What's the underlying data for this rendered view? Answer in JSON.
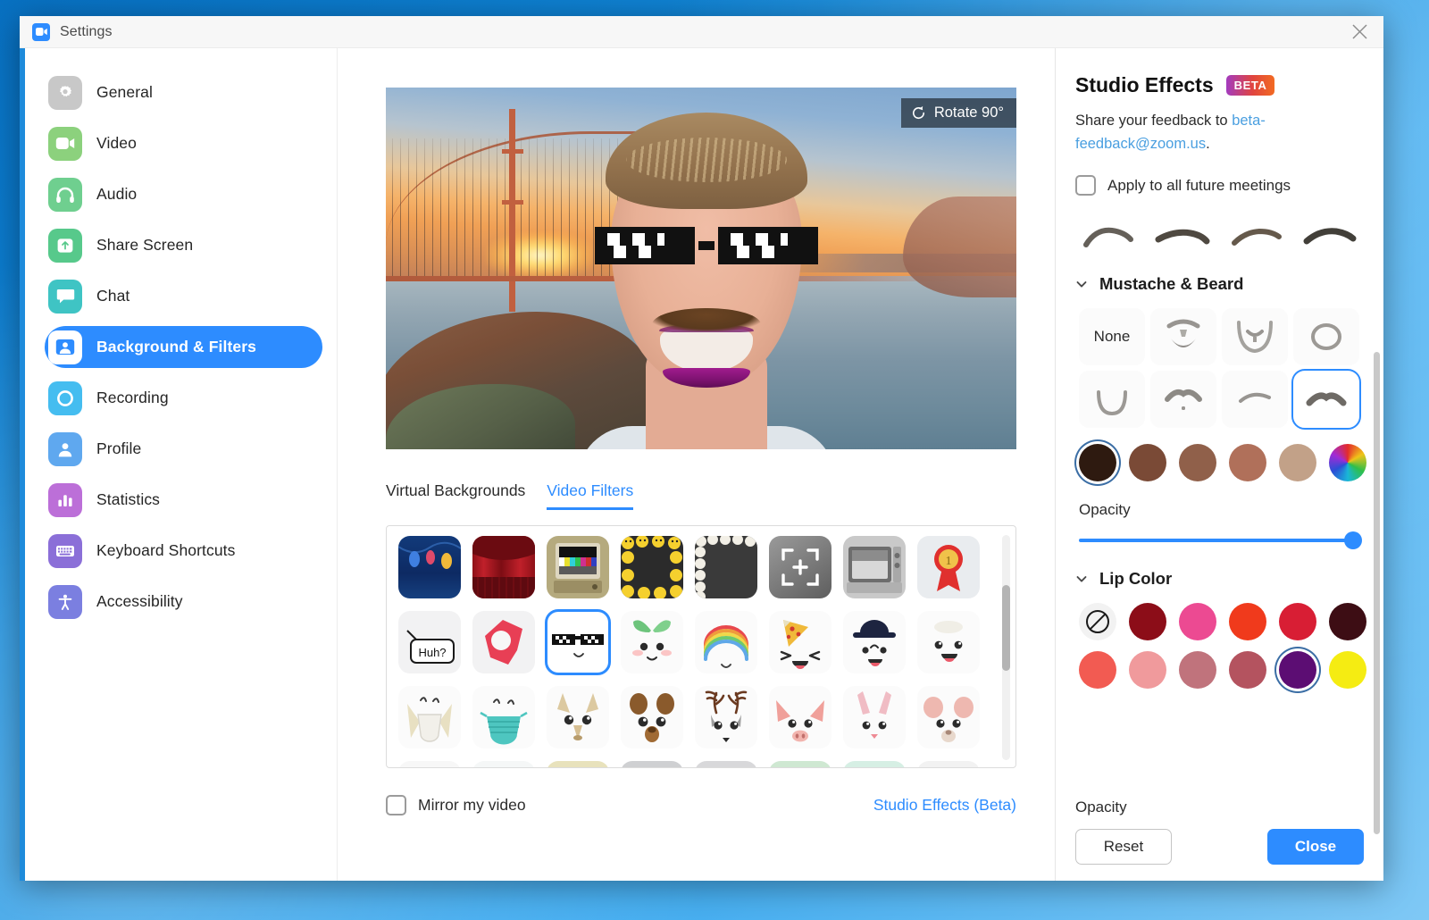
{
  "window": {
    "title": "Settings",
    "logo_icon": "zoom-camera-icon",
    "close_icon": "close-x-icon"
  },
  "sidebar": {
    "items": [
      {
        "label": "General",
        "icon": "gear-icon",
        "color": "#c8c8c8",
        "active": false
      },
      {
        "label": "Video",
        "icon": "camera-icon",
        "color": "#8cd17d",
        "active": false
      },
      {
        "label": "Audio",
        "icon": "headphones-icon",
        "color": "#6fcf8f",
        "active": false
      },
      {
        "label": "Share Screen",
        "icon": "upload-icon",
        "color": "#57c98b",
        "active": false
      },
      {
        "label": "Chat",
        "icon": "chat-icon",
        "color": "#3fc4c4",
        "active": false
      },
      {
        "label": "Background & Filters",
        "icon": "person-frame-icon",
        "color": "#ffffff",
        "active": true
      },
      {
        "label": "Recording",
        "icon": "record-icon",
        "color": "#45bdf0",
        "active": false
      },
      {
        "label": "Profile",
        "icon": "user-icon",
        "color": "#5fa8ef",
        "active": false
      },
      {
        "label": "Statistics",
        "icon": "bar-chart-icon",
        "color": "#bc6fd8",
        "active": false
      },
      {
        "label": "Keyboard Shortcuts",
        "icon": "keyboard-icon",
        "color": "#8b6fd8",
        "active": false
      },
      {
        "label": "Accessibility",
        "icon": "accessibility-icon",
        "color": "#7b7fe0",
        "active": false
      }
    ],
    "accent_color": "#1e8bdb",
    "active_color": "#2d8cff"
  },
  "preview": {
    "rotate_button": "Rotate 90°",
    "rotate_icon": "rotate-ccw-icon",
    "description": "Self-view video with Golden Gate Bridge virtual background, pixel sunglasses video filter, mustache and lip color studio effects"
  },
  "tabs": [
    {
      "label": "Virtual Backgrounds",
      "active": false
    },
    {
      "label": "Video Filters",
      "active": true
    }
  ],
  "filters": {
    "scrollbar_visible": true,
    "items": [
      {
        "name": "string-lights",
        "selected": false
      },
      {
        "name": "red-curtain",
        "selected": false
      },
      {
        "name": "retro-tv-test-pattern",
        "selected": false
      },
      {
        "name": "emoji-frame",
        "selected": false
      },
      {
        "name": "pearl-frame",
        "selected": false
      },
      {
        "name": "focus-crop-frame",
        "selected": false
      },
      {
        "name": "vintage-television",
        "selected": false
      },
      {
        "name": "first-place-ribbon",
        "selected": false
      },
      {
        "name": "huh-speech-bubble",
        "selected": false,
        "caption": "Huh?"
      },
      {
        "name": "red-lips",
        "selected": false
      },
      {
        "name": "pixel-sunglasses",
        "selected": true
      },
      {
        "name": "sprout-face",
        "selected": false
      },
      {
        "name": "rainbow-arc",
        "selected": false
      },
      {
        "name": "pizza-face",
        "selected": false
      },
      {
        "name": "baseball-cap-face",
        "selected": false
      },
      {
        "name": "blush-face",
        "selected": false
      },
      {
        "name": "n95-mask",
        "selected": false
      },
      {
        "name": "surgical-mask",
        "selected": false
      },
      {
        "name": "fox-face",
        "selected": false
      },
      {
        "name": "bear-face",
        "selected": false
      },
      {
        "name": "reindeer-face",
        "selected": false
      },
      {
        "name": "pig-face",
        "selected": false
      },
      {
        "name": "bunny-face",
        "selected": false
      },
      {
        "name": "mouse-face",
        "selected": false
      }
    ]
  },
  "bottom": {
    "mirror_label": "Mirror my video",
    "mirror_checked": false,
    "studio_link": "Studio Effects (Beta)"
  },
  "studio": {
    "title": "Studio Effects",
    "badge": "BETA",
    "feedback_prefix": "Share your feedback to",
    "feedback_email": "beta-feedback@zoom.us",
    "feedback_suffix": ".",
    "apply_all_label": "Apply to all future meetings",
    "apply_all_checked": false,
    "eyebrows": [
      {
        "name": "eyebrow-soft-arch"
      },
      {
        "name": "eyebrow-straight-thick"
      },
      {
        "name": "eyebrow-angled"
      },
      {
        "name": "eyebrow-rounded-bold"
      }
    ],
    "mustache_section": {
      "title": "Mustache & Beard",
      "expanded": true,
      "none_label": "None",
      "styles": [
        {
          "name": "none",
          "selected": false
        },
        {
          "name": "full-beard",
          "selected": false
        },
        {
          "name": "chin-strap-beard",
          "selected": false
        },
        {
          "name": "circle-beard",
          "selected": false
        },
        {
          "name": "goatee-outline",
          "selected": false
        },
        {
          "name": "handlebar-mustache",
          "selected": false
        },
        {
          "name": "thin-mustache",
          "selected": false
        },
        {
          "name": "chevron-mustache",
          "selected": true
        }
      ],
      "colors": [
        {
          "hex": "#2e1a10",
          "selected": true
        },
        {
          "hex": "#7a4a36",
          "selected": false
        },
        {
          "hex": "#90604a",
          "selected": false
        },
        {
          "hex": "#b0705a",
          "selected": false
        },
        {
          "hex": "#c2a188",
          "selected": false
        },
        {
          "hex": "wheel",
          "selected": false
        }
      ],
      "opacity_label": "Opacity",
      "opacity_value": 100
    },
    "lip_section": {
      "title": "Lip Color",
      "expanded": true,
      "colors": [
        {
          "hex": "none",
          "selected": false
        },
        {
          "hex": "#8c0d18",
          "selected": false
        },
        {
          "hex": "#ec4a92",
          "selected": false
        },
        {
          "hex": "#f03a1c",
          "selected": false
        },
        {
          "hex": "#d81e34",
          "selected": false
        },
        {
          "hex": "#3d0d14",
          "selected": false
        },
        {
          "hex": "#f25b52",
          "selected": false
        },
        {
          "hex": "#f09a9c",
          "selected": false
        },
        {
          "hex": "#c0737c",
          "selected": false
        },
        {
          "hex": "#b4535f",
          "selected": false
        },
        {
          "hex": "#5c0d73",
          "selected": true
        },
        {
          "hex": "#f5ec12",
          "selected": false
        }
      ],
      "opacity_label": "Opacity"
    },
    "reset_label": "Reset",
    "close_label": "Close"
  }
}
